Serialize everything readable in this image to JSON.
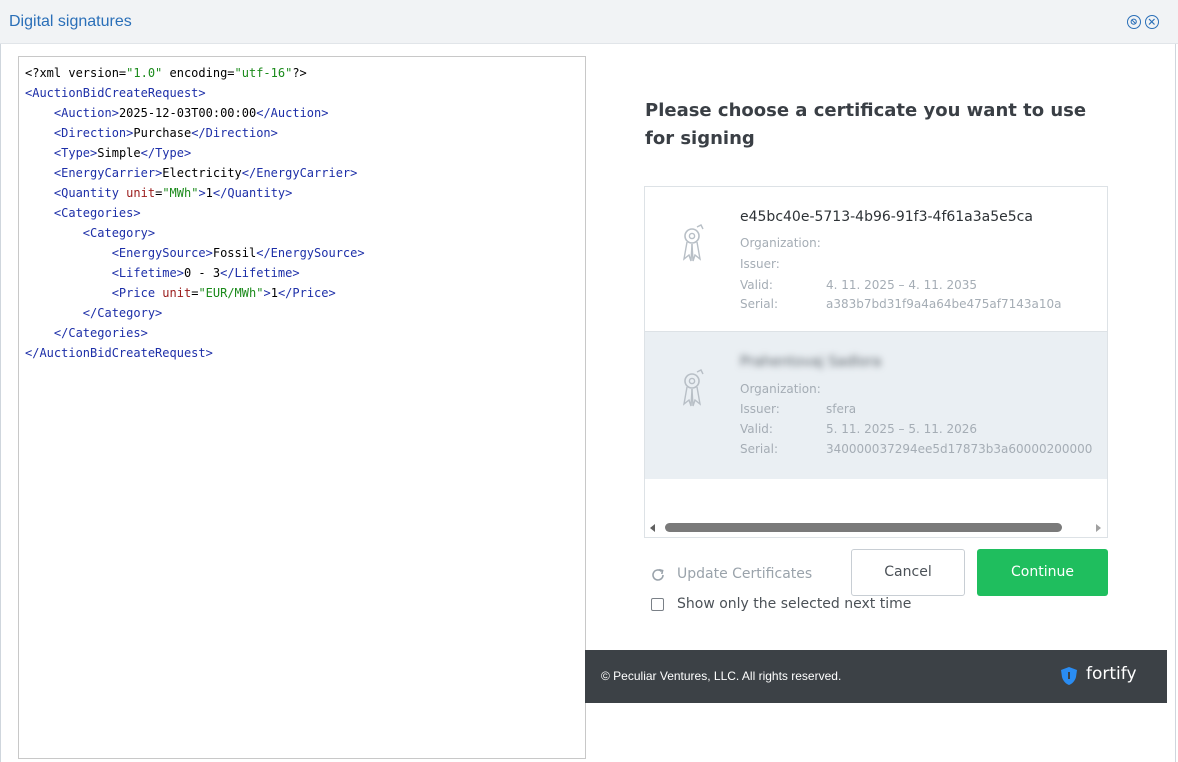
{
  "window": {
    "title": "Digital signatures",
    "buttons": [
      "minimize-icon",
      "close-icon"
    ]
  },
  "xml": {
    "lines": [
      "<?xml version=\"1.0\" encoding=\"utf-16\"?>",
      "<AuctionBidCreateRequest>",
      "    <Auction>2025-12-03T00:00:00</Auction>",
      "    <Direction>Purchase</Direction>",
      "    <Type>Simple</Type>",
      "    <EnergyCarrier>Electricity</EnergyCarrier>",
      "    <Quantity unit=\"MWh\">1</Quantity>",
      "    <Categories>",
      "        <Category>",
      "            <EnergySource>Fossil</EnergySource>",
      "            <Lifetime>0 - 3</Lifetime>",
      "            <Price unit=\"EUR/MWh\">1</Price>",
      "        </Category>",
      "    </Categories>",
      "</AuctionBidCreateRequest>"
    ]
  },
  "dialog": {
    "heading": "Please choose a certificate you want to use for signing",
    "labels": {
      "organization": "Organization:",
      "issuer": "Issuer:",
      "valid": "Valid:",
      "serial": "Serial:"
    },
    "certificates": [
      {
        "name": "e45bc40e-5713-4b96-91f3-4f61a3a5e5ca",
        "organization": "",
        "issuer": "",
        "valid": "4. 11. 2025  –  4. 11. 2035",
        "serial": "a383b7bd31f9a4a64be475af7143a10a",
        "selected": false
      },
      {
        "name": "Prahentovaj Sadlora",
        "organization": "",
        "issuer": "sfera",
        "valid": "5. 11. 2025  –  5. 11. 2026",
        "serial": "340000037294ee5d17873b3a60000200000",
        "selected": true
      }
    ],
    "update_label": "Update Certificates",
    "cancel_label": "Cancel",
    "continue_label": "Continue",
    "checkbox_label": "Show only the selected next time",
    "checkbox_checked": false
  },
  "footer": {
    "copyright": "© Peculiar Ventures, LLC. All rights reserved.",
    "brand": "fortify"
  },
  "colors": {
    "title": "#2a6fb8",
    "accent_green": "#1fbe5e",
    "footer_bg": "#3c4146",
    "brand_shield": "#2a8cf2"
  }
}
